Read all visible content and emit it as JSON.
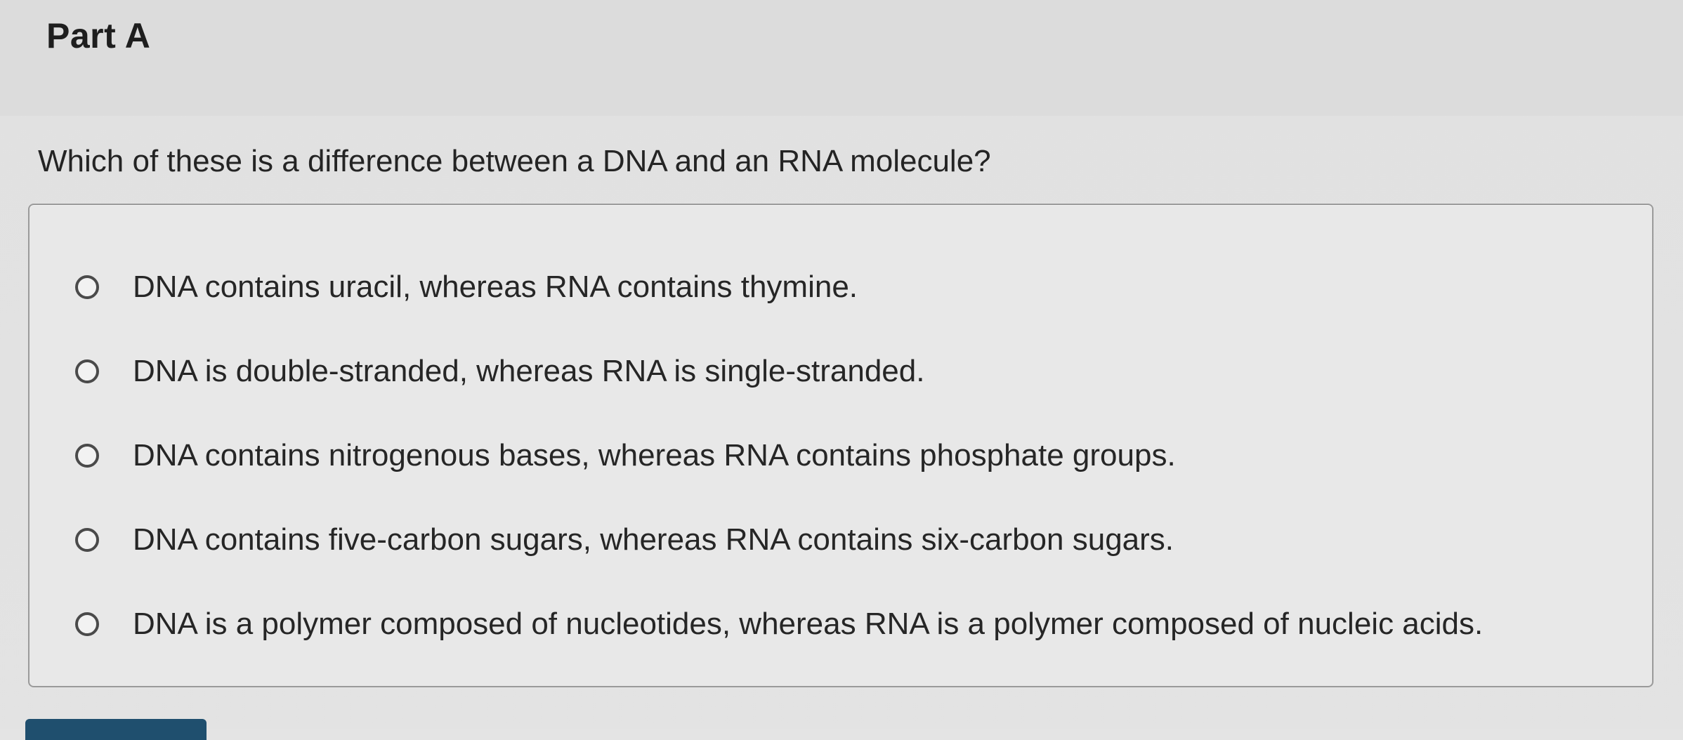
{
  "part": {
    "title": "Part A"
  },
  "question": {
    "text": "Which of these is a difference between a DNA and an RNA molecule?"
  },
  "choices": [
    {
      "label": "DNA contains uracil, whereas RNA contains thymine.",
      "selected": false
    },
    {
      "label": "DNA is double-stranded, whereas RNA is single-stranded.",
      "selected": false
    },
    {
      "label": "DNA contains nitrogenous bases, whereas RNA contains phosphate groups.",
      "selected": false
    },
    {
      "label": "DNA contains five-carbon sugars, whereas RNA contains six-carbon sugars.",
      "selected": false
    },
    {
      "label": "DNA is a polymer composed of nucleotides, whereas RNA is a polymer composed of nucleic acids.",
      "selected": false
    }
  ],
  "colors": {
    "submit_button": "#1f4f6e",
    "radio_border": "#4a4a4a"
  }
}
